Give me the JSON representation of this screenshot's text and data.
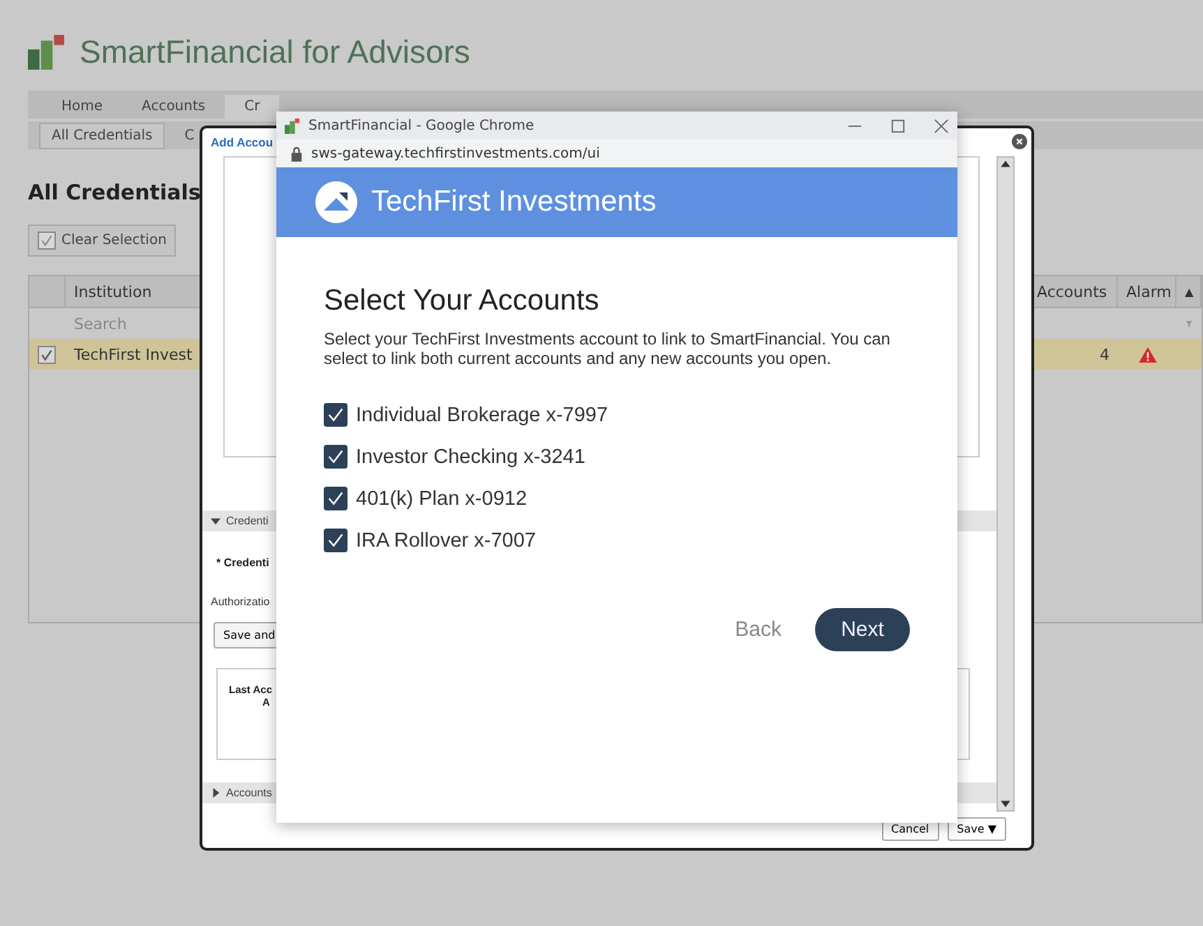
{
  "app": {
    "title": "SmartFinancial for Advisors"
  },
  "tabs": [
    {
      "label": "Home",
      "selected": false
    },
    {
      "label": "Accounts",
      "selected": false
    },
    {
      "label": "Cr",
      "selected": true
    }
  ],
  "subtabs": [
    {
      "label": "All Credentials",
      "selected": true
    },
    {
      "label": "C",
      "selected": false
    }
  ],
  "heading": "All Credentials",
  "clear_selection": {
    "label": "Clear Selection",
    "checked": true
  },
  "table": {
    "columns": [
      "Institution",
      "Accounts",
      "Alarm"
    ],
    "sort_icon": "▲",
    "search": {
      "placeholder": "Search"
    },
    "rows": [
      {
        "checked": true,
        "selected": true,
        "institution": "TechFirst Invest",
        "accounts": "4",
        "alarm": true
      }
    ]
  },
  "modal": {
    "title": "Add Accou",
    "section_1": "Credenti",
    "field_label": "* Credenti",
    "auth_label": "Authorizatio",
    "save_and": "Save and",
    "last_lines": [
      "Last Acc",
      "A"
    ],
    "section_2": "Accounts",
    "buttons": [
      "Cancel",
      "Save ▼"
    ]
  },
  "browser": {
    "title": "SmartFinancial - Google Chrome",
    "url": "sws-gateway.techfirstinvestments.com/ui",
    "brand": "TechFirst Investments",
    "heading": "Select Your Accounts",
    "description": "Select your TechFirst Investments account to link to SmartFinancial. You can select to link both current accounts and any new accounts you open.",
    "accounts": [
      {
        "label": "Individual Brokerage x-7997",
        "checked": true
      },
      {
        "label": "Investor Checking x-3241",
        "checked": true
      },
      {
        "label": "401(k) Plan x-0912",
        "checked": true
      },
      {
        "label": "IRA Rollover x-7007",
        "checked": true
      }
    ],
    "back": "Back",
    "next": "Next"
  }
}
